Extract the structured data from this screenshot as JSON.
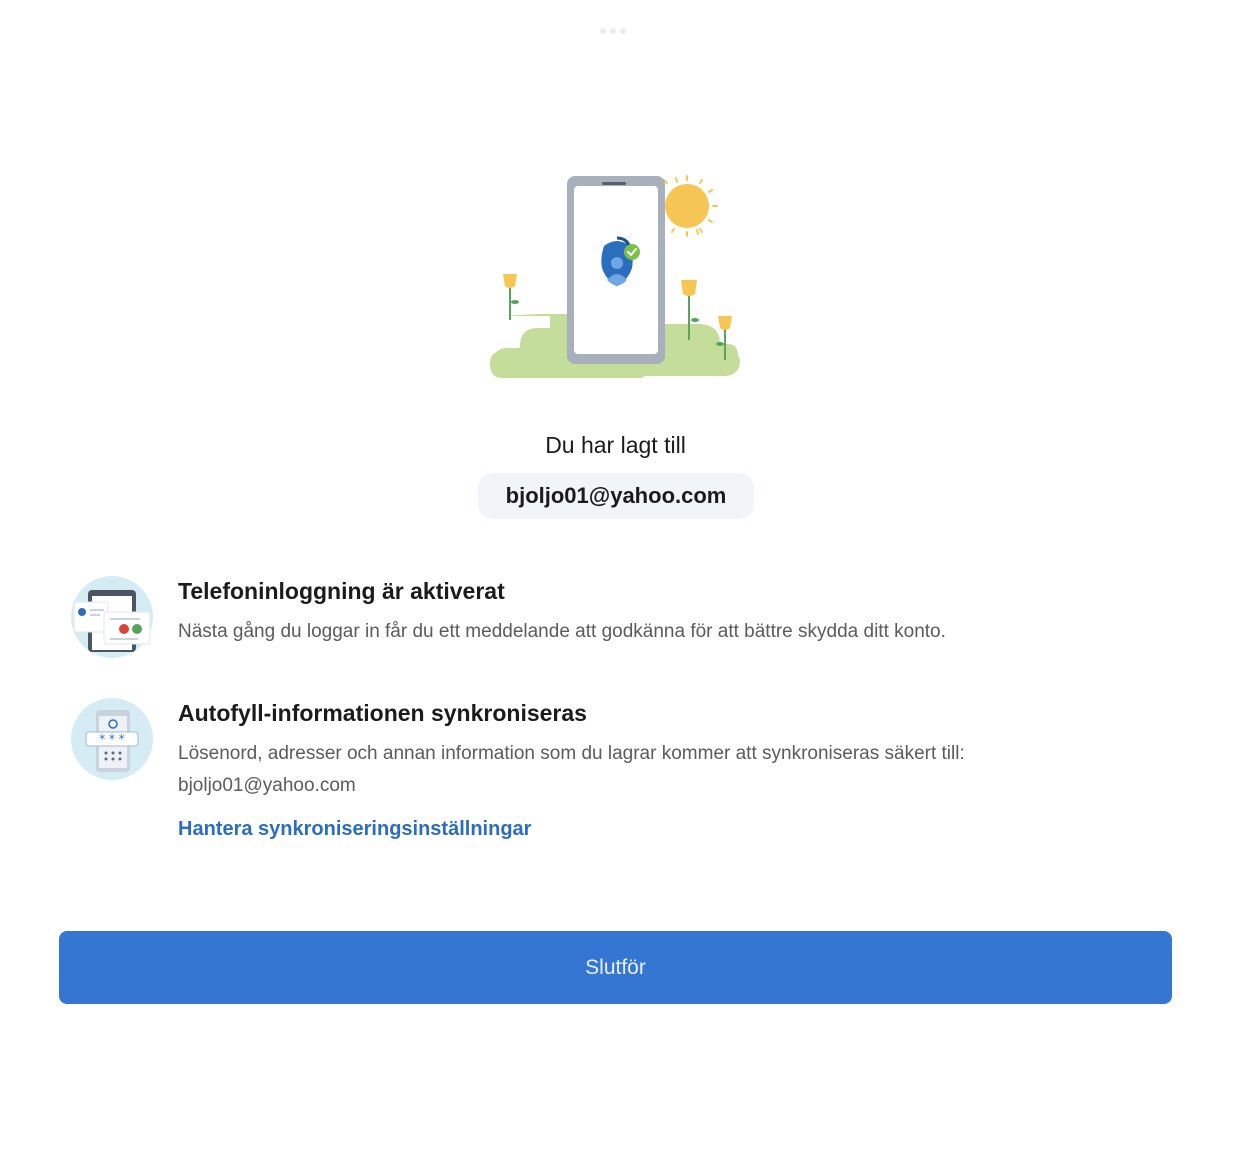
{
  "header": {
    "added_label": "Du har lagt till",
    "account_email": "bjoljo01@yahoo.com"
  },
  "features": [
    {
      "title": "Telefoninloggning är aktiverat",
      "description": "Nästa gång du loggar in får du ett meddelande att godkänna för att bättre skydda ditt konto.",
      "icon": "phone-signin-icon"
    },
    {
      "title": "Autofyll-informationen synkroniseras",
      "description": "Lösenord, adresser och annan information som du lagrar kommer att synkroniseras säkert till: bjoljo01@yahoo.com",
      "link_label": "Hantera synkroniseringsinställningar",
      "icon": "autofill-sync-icon"
    }
  ],
  "footer": {
    "finish_label": "Slutför"
  },
  "colors": {
    "accent": "#3476d2",
    "link": "#2a6ebd",
    "pill_bg": "#f1f4f9"
  }
}
